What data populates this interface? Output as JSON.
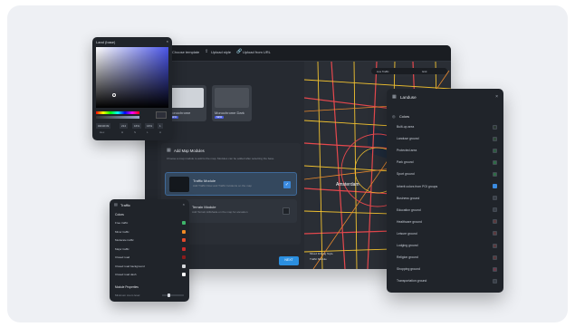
{
  "main": {
    "tabs": [
      "Choose template",
      "Upload style",
      "Upload from URL"
    ],
    "template_section": {
      "templates": [
        {
          "name": "Monochrome",
          "badge": "NEW"
        },
        {
          "name": "Monochrome Dark",
          "badge": "NEW"
        }
      ]
    },
    "modules_section": {
      "title": "Add Map Modules",
      "description": "Choose a map module to add to the map. Modules can be added after selecting the base.",
      "modules": [
        {
          "name": "Traffic Module",
          "desc": "Add Traffic Flow and Traffic Incidents on the map",
          "checked": true
        },
        {
          "name": "Terrain Module",
          "desc": "Add Terrain Hillshade on the map for elevation",
          "checked": false
        }
      ]
    },
    "next_label": "NEXT",
    "map": {
      "city_label": "Amsterdam",
      "legend_title": "Mixed Driving Style",
      "legend_item": "Traffic Module",
      "toggle_labels": [
        "Live Traffic",
        "Grid"
      ]
    }
  },
  "color_picker": {
    "title": "Land (base)",
    "hex": "#2D2F39",
    "values": [
      "214",
      "16%",
      "16%",
      "1"
    ],
    "channels": [
      "Hex",
      "H",
      "S",
      "L",
      "A"
    ]
  },
  "traffic": {
    "title": "Traffic",
    "section": "Colors",
    "rows": [
      {
        "label": "Free traffic",
        "color": "#3fb56a"
      },
      {
        "label": "Minor traffic",
        "color": "#f08a24"
      },
      {
        "label": "Moderate traffic",
        "color": "#e24a2b"
      },
      {
        "label": "Major traffic",
        "color": "#c92a2a"
      },
      {
        "label": "Closed road",
        "color": "#8a1c1c"
      },
      {
        "label": "Closed road background",
        "color": "#d6d8dc"
      },
      {
        "label": "Closed road dash",
        "color": "#ffffff"
      }
    ],
    "footer_section": "Module Properties",
    "footer_row": "Minimum zoom level"
  },
  "landuse": {
    "title": "Landuse",
    "section": "Colors",
    "rows": [
      {
        "label": "Built-up area",
        "color": "#2d3a34",
        "checked": false
      },
      {
        "label": "Landuse ground",
        "color": "#2f4a3a",
        "checked": false
      },
      {
        "label": "Protected area",
        "color": "#2f5a42",
        "checked": false
      },
      {
        "label": "Park ground",
        "color": "#2f6b46",
        "checked": false
      },
      {
        "label": "Sport ground",
        "color": "#2f6b46",
        "checked": false
      },
      {
        "label": "Inherit colors from POI groups",
        "color": "#3b8be0",
        "checked": true
      },
      {
        "label": "Business ground",
        "color": "#3a4048",
        "checked": false
      },
      {
        "label": "Education ground",
        "color": "#3a4048",
        "checked": false
      },
      {
        "label": "Healthcare ground",
        "color": "#5a3a3e",
        "checked": false
      },
      {
        "label": "Leisure ground",
        "color": "#5a3a3e",
        "checked": false
      },
      {
        "label": "Lodging ground",
        "color": "#5a3a3e",
        "checked": false
      },
      {
        "label": "Religion ground",
        "color": "#5a3a3e",
        "checked": false
      },
      {
        "label": "Shopping ground",
        "color": "#6a3a4a",
        "checked": false
      },
      {
        "label": "Transportation ground",
        "color": "#3a4048",
        "checked": false
      }
    ]
  }
}
